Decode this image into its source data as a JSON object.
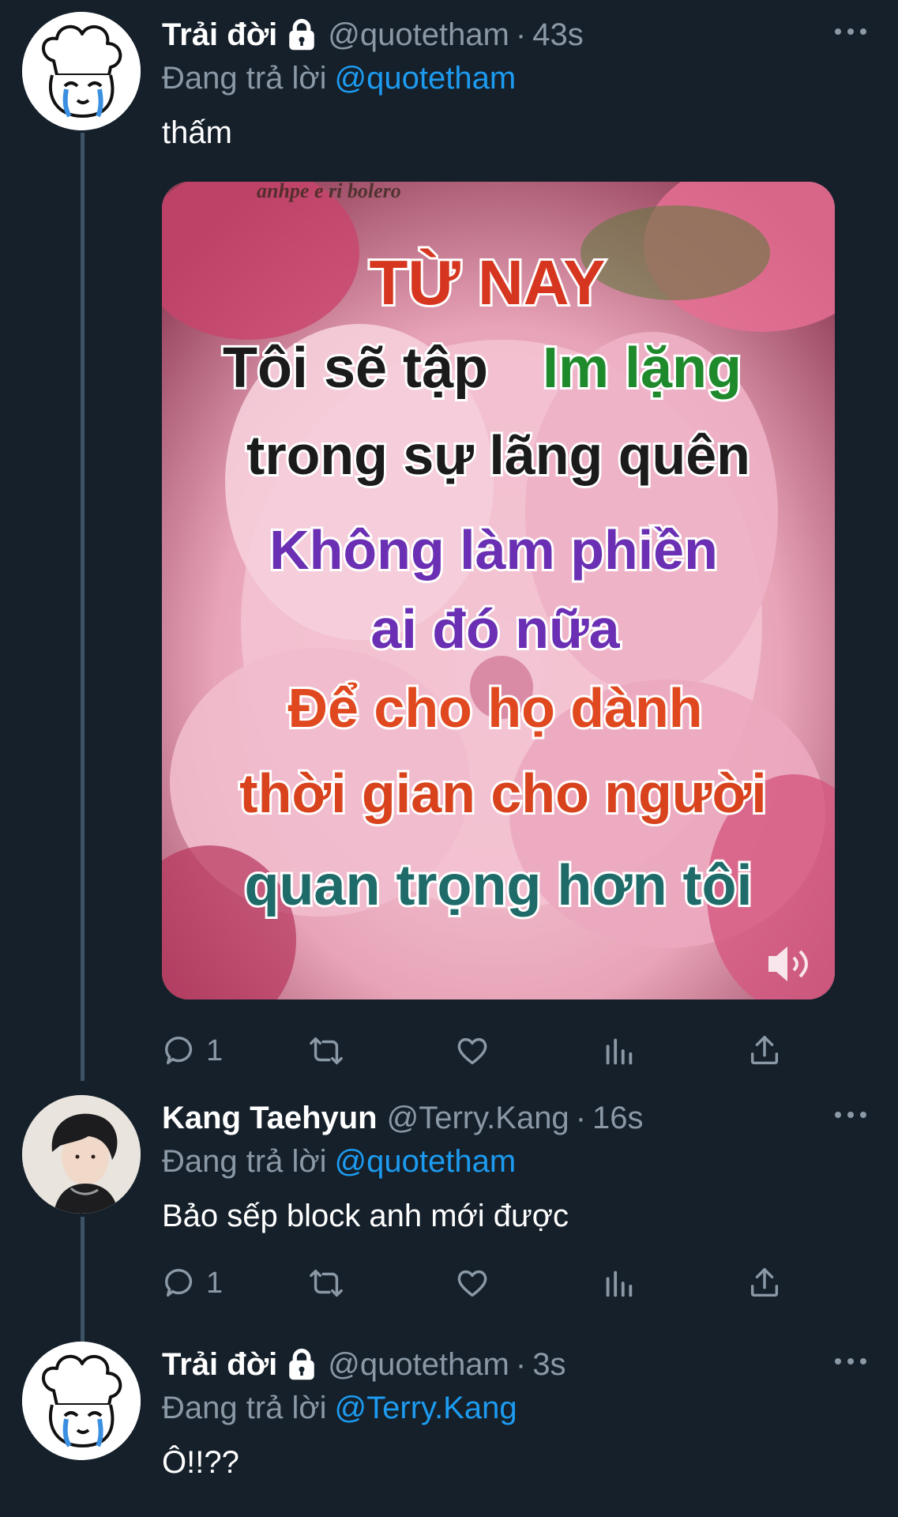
{
  "tweets": [
    {
      "name": "Trải đời",
      "locked": true,
      "handle": "@quotetham",
      "sep": "·",
      "time": "43s",
      "reply_prefix": "Đang trả lời",
      "reply_to": "@quotetham",
      "text": "thấm",
      "avatar_icon": "crying-chef-cartoon-icon",
      "media": {
        "watermark": "anhpe e ri bolero",
        "lines": [
          {
            "text": "TỪ NAY",
            "color": "#d6361f"
          },
          {
            "text": "Tôi sẽ tập",
            "color": "#1b1b1b"
          },
          {
            "text": "Im lặng",
            "color": "#1f8a2b"
          },
          {
            "text": "trong sự lãng quên",
            "color": "#1b1b1b"
          },
          {
            "text": "Không làm phiền",
            "color": "#6a2fb3"
          },
          {
            "text": "ai đó nữa",
            "color": "#6a2fb3"
          },
          {
            "text": "Để cho họ dành",
            "color": "#e0481f"
          },
          {
            "text": "thời gian cho người",
            "color": "#d8431e"
          },
          {
            "text": "quan trọng hơn tôi",
            "color": "#1e6b6a"
          }
        ]
      },
      "actions": {
        "reply_count": "1"
      }
    },
    {
      "name": "Kang Taehyun",
      "locked": false,
      "handle": "@Terry.Kang",
      "sep": "·",
      "time": "16s",
      "reply_prefix": "Đang trả lời",
      "reply_to": "@quotetham",
      "text": "Bảo sếp block anh mới được",
      "avatar_icon": "profile-photo",
      "actions": {
        "reply_count": "1"
      }
    },
    {
      "name": "Trải đời",
      "locked": true,
      "handle": "@quotetham",
      "sep": "·",
      "time": "3s",
      "reply_prefix": "Đang trả lời",
      "reply_to": "@Terry.Kang",
      "text": "Ô!!??",
      "avatar_icon": "crying-chef-cartoon-icon"
    }
  ],
  "colors": {
    "background": "#15202b",
    "secondary_text": "#8b98a5",
    "link": "#1d9bf0",
    "thread_line": "#3d5466"
  }
}
